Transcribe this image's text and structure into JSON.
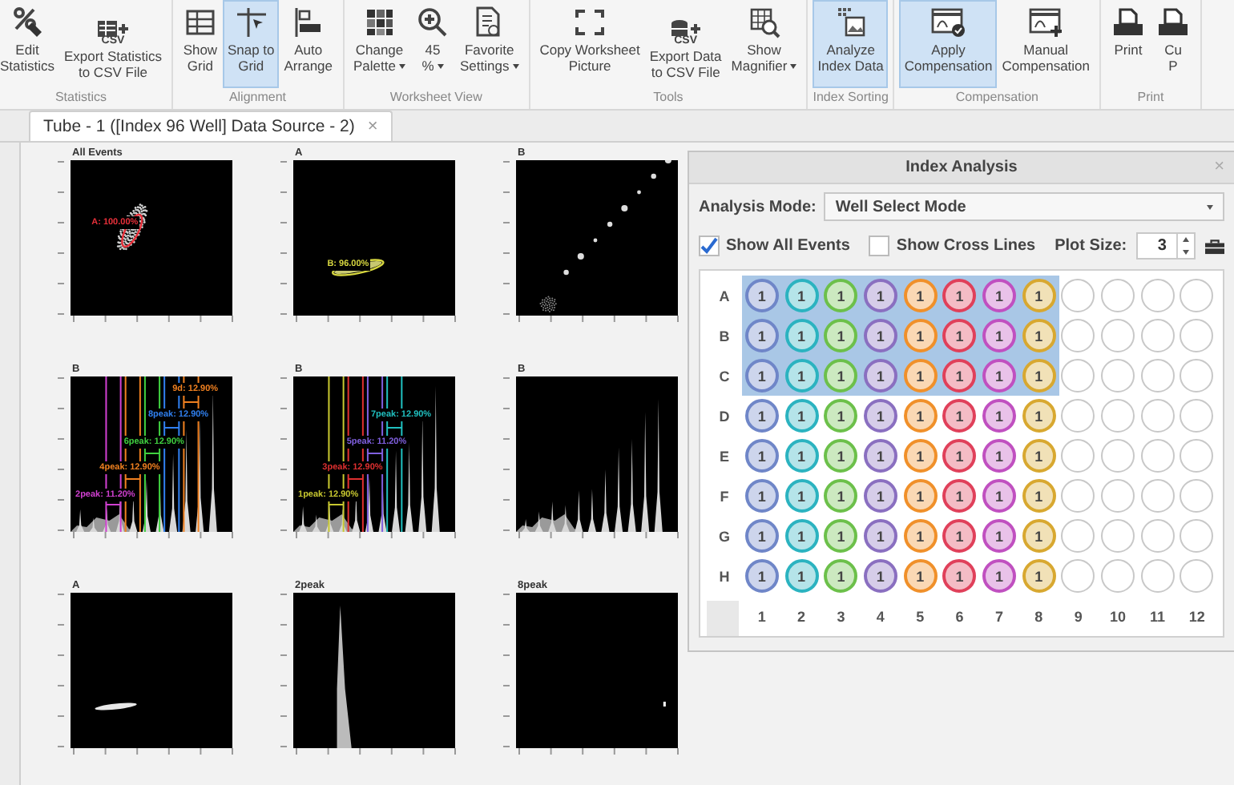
{
  "ribbon": {
    "groups": [
      {
        "label": "Statistics",
        "buttons": [
          {
            "lines": [
              "Edit",
              "Statistics"
            ],
            "selected": false
          },
          {
            "lines": [
              "Export Statistics",
              "to CSV File"
            ],
            "icon_text": "CSV",
            "selected": false
          }
        ]
      },
      {
        "label": "Alignment",
        "buttons": [
          {
            "lines": [
              "Show",
              "Grid"
            ],
            "selected": false
          },
          {
            "lines": [
              "Snap to",
              "Grid"
            ],
            "selected": true
          },
          {
            "lines": [
              "Auto",
              "Arrange"
            ],
            "selected": false
          }
        ]
      },
      {
        "label": "Worksheet View",
        "buttons": [
          {
            "lines": [
              "Change",
              "Palette"
            ],
            "dropdown": true,
            "selected": false
          },
          {
            "lines": [
              "45",
              "%"
            ],
            "dropdown": true,
            "selected": false
          },
          {
            "lines": [
              "Favorite",
              "Settings"
            ],
            "dropdown": true,
            "selected": false
          }
        ]
      },
      {
        "label": "Tools",
        "buttons": [
          {
            "lines": [
              "Copy Worksheet",
              "Picture"
            ],
            "selected": false
          },
          {
            "lines": [
              "Export Data",
              "to CSV File"
            ],
            "icon_text": "CSV",
            "selected": false
          },
          {
            "lines": [
              "Show",
              "Magnifier"
            ],
            "dropdown": true,
            "selected": false
          }
        ]
      },
      {
        "label": "Index Sorting",
        "buttons": [
          {
            "lines": [
              "Analyze",
              "Index Data"
            ],
            "selected": true
          }
        ]
      },
      {
        "label": "Compensation",
        "buttons": [
          {
            "lines": [
              "Apply",
              "Compensation"
            ],
            "selected": true
          },
          {
            "lines": [
              "Manual",
              "Compensation"
            ],
            "selected": false
          }
        ]
      },
      {
        "label": "Print",
        "buttons": [
          {
            "lines": [
              "Print"
            ],
            "selected": false
          },
          {
            "lines": [
              "Cu",
              "P"
            ],
            "selected": false
          }
        ]
      }
    ]
  },
  "document_tab": {
    "label": "Tube - 1 ([Index 96 Well] Data Source - 2)",
    "close": "×"
  },
  "plots": [
    {
      "title": "All Events",
      "kind": "cluster",
      "gates": [
        {
          "label": "A: 100.00%",
          "color": "#e8303a"
        }
      ]
    },
    {
      "title": "A",
      "kind": "ellipse",
      "gates": [
        {
          "label": "B: 96.00%",
          "color": "#d8d840"
        }
      ]
    },
    {
      "title": "B",
      "kind": "dots"
    },
    {
      "title": "B",
      "kind": "histogram",
      "gates": [
        {
          "label": "9d: 12.90%",
          "color": "#f08020"
        },
        {
          "label": "8peak: 12.90%",
          "color": "#3080f0"
        },
        {
          "label": "6peak: 12.90%",
          "color": "#40d040"
        },
        {
          "label": "4peak: 12.90%",
          "color": "#f08020"
        },
        {
          "label": "2peak: 11.20%",
          "color": "#d040d0"
        }
      ]
    },
    {
      "title": "B",
      "kind": "histogram",
      "gates": [
        {
          "label": "7peak: 12.90%",
          "color": "#20c0c0"
        },
        {
          "label": "5peak: 11.20%",
          "color": "#8060e0"
        },
        {
          "label": "3peak: 12.90%",
          "color": "#e03030"
        },
        {
          "label": "1peak: 12.90%",
          "color": "#c8c830"
        }
      ]
    },
    {
      "title": "B",
      "kind": "histogram"
    },
    {
      "title": "A",
      "kind": "streak"
    },
    {
      "title": "2peak",
      "kind": "peak"
    },
    {
      "title": "8peak",
      "kind": "dot"
    }
  ],
  "index_analysis": {
    "title": "Index Analysis",
    "close": "×",
    "analysis_mode": {
      "label": "Analysis Mode:",
      "value": "Well Select Mode"
    },
    "show_all_events": {
      "label": "Show All Events",
      "checked": true
    },
    "show_cross_lines": {
      "label": "Show Cross Lines",
      "checked": false
    },
    "plot_size": {
      "label": "Plot Size:",
      "value": "3"
    },
    "column_labels": [
      "1",
      "2",
      "3",
      "4",
      "5",
      "6",
      "7",
      "8",
      "9",
      "10",
      "11",
      "12"
    ],
    "rows": [
      {
        "label": "A",
        "wells": [
          {
            "count": "1",
            "color": "#6f86c8",
            "selected": true
          },
          {
            "count": "1",
            "color": "#2bb3c0",
            "selected": true
          },
          {
            "count": "1",
            "color": "#6cc04a",
            "selected": true
          },
          {
            "count": "1",
            "color": "#8a6fc0",
            "selected": true
          },
          {
            "count": "1",
            "color": "#f0902a",
            "selected": true
          },
          {
            "count": "1",
            "color": "#e0405a",
            "selected": true
          },
          {
            "count": "1",
            "color": "#c050c0",
            "selected": true
          },
          {
            "count": "1",
            "color": "#d8a830",
            "selected": true
          },
          {
            "selected": false
          },
          {
            "selected": false
          },
          {
            "selected": false
          },
          {
            "selected": false
          }
        ]
      },
      {
        "label": "B",
        "wells": [
          {
            "count": "1",
            "color": "#6f86c8",
            "selected": true
          },
          {
            "count": "1",
            "color": "#2bb3c0",
            "selected": true
          },
          {
            "count": "1",
            "color": "#6cc04a",
            "selected": true
          },
          {
            "count": "1",
            "color": "#8a6fc0",
            "selected": true
          },
          {
            "count": "1",
            "color": "#f0902a",
            "selected": true
          },
          {
            "count": "1",
            "color": "#e0405a",
            "selected": true
          },
          {
            "count": "1",
            "color": "#c050c0",
            "selected": true
          },
          {
            "count": "1",
            "color": "#d8a830",
            "selected": true
          },
          {
            "selected": false
          },
          {
            "selected": false
          },
          {
            "selected": false
          },
          {
            "selected": false
          }
        ]
      },
      {
        "label": "C",
        "wells": [
          {
            "count": "1",
            "color": "#6f86c8",
            "selected": true
          },
          {
            "count": "1",
            "color": "#2bb3c0",
            "selected": true
          },
          {
            "count": "1",
            "color": "#6cc04a",
            "selected": true
          },
          {
            "count": "1",
            "color": "#8a6fc0",
            "selected": true
          },
          {
            "count": "1",
            "color": "#f0902a",
            "selected": true
          },
          {
            "count": "1",
            "color": "#e0405a",
            "selected": true
          },
          {
            "count": "1",
            "color": "#c050c0",
            "selected": true
          },
          {
            "count": "1",
            "color": "#d8a830",
            "selected": true
          },
          {
            "selected": false
          },
          {
            "selected": false
          },
          {
            "selected": false
          },
          {
            "selected": false
          }
        ]
      },
      {
        "label": "D",
        "wells": [
          {
            "count": "1",
            "color": "#6f86c8",
            "selected": false
          },
          {
            "count": "1",
            "color": "#2bb3c0",
            "selected": false
          },
          {
            "count": "1",
            "color": "#6cc04a",
            "selected": false
          },
          {
            "count": "1",
            "color": "#8a6fc0",
            "selected": false
          },
          {
            "count": "1",
            "color": "#f0902a",
            "selected": false
          },
          {
            "count": "1",
            "color": "#e0405a",
            "selected": false
          },
          {
            "count": "1",
            "color": "#c050c0",
            "selected": false
          },
          {
            "count": "1",
            "color": "#d8a830",
            "selected": false
          },
          {
            "selected": false
          },
          {
            "selected": false
          },
          {
            "selected": false
          },
          {
            "selected": false
          }
        ]
      },
      {
        "label": "E",
        "wells": [
          {
            "count": "1",
            "color": "#6f86c8",
            "selected": false
          },
          {
            "count": "1",
            "color": "#2bb3c0",
            "selected": false
          },
          {
            "count": "1",
            "color": "#6cc04a",
            "selected": false
          },
          {
            "count": "1",
            "color": "#8a6fc0",
            "selected": false
          },
          {
            "count": "1",
            "color": "#f0902a",
            "selected": false
          },
          {
            "count": "1",
            "color": "#e0405a",
            "selected": false
          },
          {
            "count": "1",
            "color": "#c050c0",
            "selected": false
          },
          {
            "count": "1",
            "color": "#d8a830",
            "selected": false
          },
          {
            "selected": false
          },
          {
            "selected": false
          },
          {
            "selected": false
          },
          {
            "selected": false
          }
        ]
      },
      {
        "label": "F",
        "wells": [
          {
            "count": "1",
            "color": "#6f86c8",
            "selected": false
          },
          {
            "count": "1",
            "color": "#2bb3c0",
            "selected": false
          },
          {
            "count": "1",
            "color": "#6cc04a",
            "selected": false
          },
          {
            "count": "1",
            "color": "#8a6fc0",
            "selected": false
          },
          {
            "count": "1",
            "color": "#f0902a",
            "selected": false
          },
          {
            "count": "1",
            "color": "#e0405a",
            "selected": false
          },
          {
            "count": "1",
            "color": "#c050c0",
            "selected": false
          },
          {
            "count": "1",
            "color": "#d8a830",
            "selected": false
          },
          {
            "selected": false
          },
          {
            "selected": false
          },
          {
            "selected": false
          },
          {
            "selected": false
          }
        ]
      },
      {
        "label": "G",
        "wells": [
          {
            "count": "1",
            "color": "#6f86c8",
            "selected": false
          },
          {
            "count": "1",
            "color": "#2bb3c0",
            "selected": false
          },
          {
            "count": "1",
            "color": "#6cc04a",
            "selected": false
          },
          {
            "count": "1",
            "color": "#8a6fc0",
            "selected": false
          },
          {
            "count": "1",
            "color": "#f0902a",
            "selected": false
          },
          {
            "count": "1",
            "color": "#e0405a",
            "selected": false
          },
          {
            "count": "1",
            "color": "#c050c0",
            "selected": false
          },
          {
            "count": "1",
            "color": "#d8a830",
            "selected": false
          },
          {
            "selected": false
          },
          {
            "selected": false
          },
          {
            "selected": false
          },
          {
            "selected": false
          }
        ]
      },
      {
        "label": "H",
        "wells": [
          {
            "count": "1",
            "color": "#6f86c8",
            "selected": false
          },
          {
            "count": "1",
            "color": "#2bb3c0",
            "selected": false
          },
          {
            "count": "1",
            "color": "#6cc04a",
            "selected": false
          },
          {
            "count": "1",
            "color": "#8a6fc0",
            "selected": false
          },
          {
            "count": "1",
            "color": "#f0902a",
            "selected": false
          },
          {
            "count": "1",
            "color": "#e0405a",
            "selected": false
          },
          {
            "count": "1",
            "color": "#c050c0",
            "selected": false
          },
          {
            "count": "1",
            "color": "#d8a830",
            "selected": false
          },
          {
            "selected": false
          },
          {
            "selected": false
          },
          {
            "selected": false
          },
          {
            "selected": false
          }
        ]
      }
    ]
  }
}
